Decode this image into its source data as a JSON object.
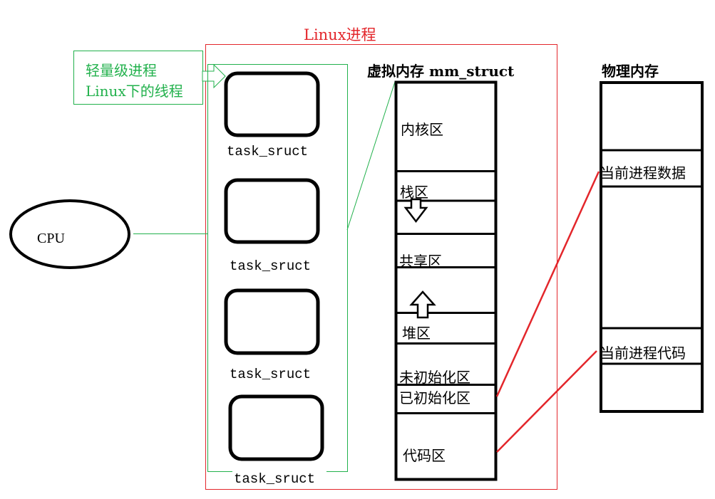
{
  "diagram": {
    "title": "Linux进程",
    "thread_note": {
      "line1": "轻量级进程",
      "line2": "Linux下的线程"
    },
    "cpu_label": "CPU",
    "task_structs": [
      {
        "label": "task_sruct"
      },
      {
        "label": "task_sruct"
      },
      {
        "label": "task_sruct"
      },
      {
        "label": "task_sruct"
      }
    ],
    "virtual_memory": {
      "header": "虚拟内存 mm_struct",
      "segments": [
        {
          "label": "内核区"
        },
        {
          "label": "栈区"
        },
        {
          "label": "共享区"
        },
        {
          "label": "堆区"
        },
        {
          "label": "未初始化区"
        },
        {
          "label": "已初始化区"
        },
        {
          "label": "代码区"
        }
      ],
      "stack_growth_arrow": "down",
      "heap_growth_arrow": "up"
    },
    "physical_memory": {
      "header": "物理内存",
      "blocks": [
        {
          "label": "当前进程数据"
        },
        {
          "label": "当前进程代码"
        }
      ]
    },
    "mappings": [
      {
        "from": "已初始化区",
        "to": "当前进程数据"
      },
      {
        "from": "代码区",
        "to": "当前进程代码"
      }
    ],
    "colors": {
      "process_border": "#e3262b",
      "thread_group": "#22b14c",
      "mapping_line": "#e3262b",
      "outline": "#000000"
    }
  }
}
